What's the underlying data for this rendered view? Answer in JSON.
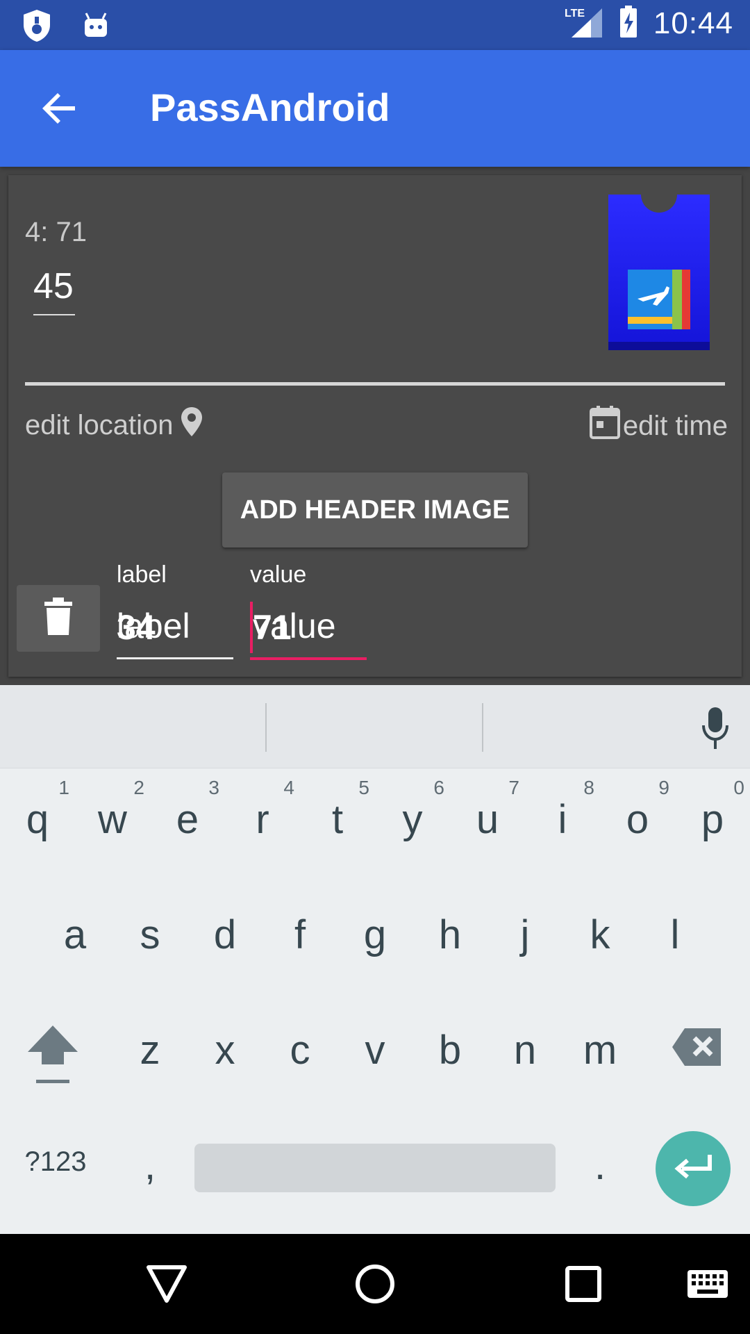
{
  "status_bar": {
    "time": "10:44",
    "network": "LTE"
  },
  "app_bar": {
    "title": "PassAndroid"
  },
  "card": {
    "small_label": "4: 71",
    "value": "45",
    "edit_location": "edit location",
    "edit_time": "edit time",
    "add_header_button": "ADD HEADER IMAGE",
    "field_label_title": "label",
    "field_value_title": "value",
    "field_label_text": "label",
    "field_value_text": "value",
    "field_label_overlap": "34",
    "field_value_overlap": "71"
  },
  "keyboard": {
    "row1": [
      {
        "k": "q",
        "n": "1"
      },
      {
        "k": "w",
        "n": "2"
      },
      {
        "k": "e",
        "n": "3"
      },
      {
        "k": "r",
        "n": "4"
      },
      {
        "k": "t",
        "n": "5"
      },
      {
        "k": "y",
        "n": "6"
      },
      {
        "k": "u",
        "n": "7"
      },
      {
        "k": "i",
        "n": "8"
      },
      {
        "k": "o",
        "n": "9"
      },
      {
        "k": "p",
        "n": "0"
      }
    ],
    "row2": [
      "a",
      "s",
      "d",
      "f",
      "g",
      "h",
      "j",
      "k",
      "l"
    ],
    "row3": [
      "z",
      "x",
      "c",
      "v",
      "b",
      "n",
      "m"
    ],
    "symbols_key": "?123",
    "comma": ",",
    "period": "."
  },
  "colors": {
    "status_bar": "#2a4fa8",
    "app_bar": "#386de6",
    "card_bg": "#494949",
    "accent_pink": "#e91e63",
    "enter_teal": "#4db6ac"
  }
}
